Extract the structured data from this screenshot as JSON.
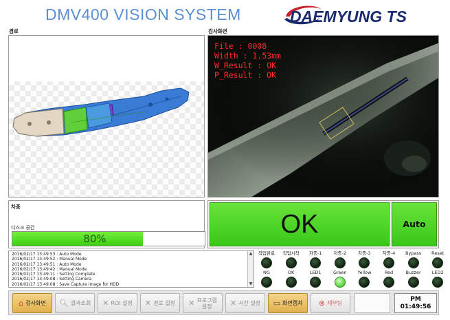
{
  "header": {
    "title": "DMV400 VISION SYSTEM",
    "logo_text": "DAEMYUNG TS"
  },
  "sections": {
    "route_label": "경로",
    "inspection_label": "검사화면",
    "car_label": "차종",
    "disk_label": "디스크 공간"
  },
  "camera_overlay": [
    "File : 0008",
    "Width : 1.53mm",
    "W_Result : OK",
    "P_Result : OK"
  ],
  "disk": {
    "percent_text": "80%",
    "fraction": 0.8
  },
  "result": {
    "main": "OK",
    "mode": "Auto"
  },
  "log": [
    "2016/02/17 13:49:53 : Auto Mode",
    "2016/02/17 13:49:52 : Manual Mode",
    "2016/02/17 13:49:51 : Auto Mode",
    "2016/02/17 13:49:42 : Manual Mode",
    "2016/02/17 13:49:11 : Setting Complete",
    "2016/02/17 13:49:08 : Setting Camera",
    "2016/02/17 13:49:08 : Save Capture Image for HDD"
  ],
  "indicators_row1": [
    {
      "label": "작업완료",
      "on": false
    },
    {
      "label": "작업시작",
      "on": false
    },
    {
      "label": "차종-1",
      "on": false
    },
    {
      "label": "차종-2",
      "on": false
    },
    {
      "label": "차종-3",
      "on": false
    },
    {
      "label": "차종-4",
      "on": false
    },
    {
      "label": "Bypass",
      "on": false
    },
    {
      "label": "Reset",
      "on": false
    }
  ],
  "indicators_row2": [
    {
      "label": "NG",
      "on": false
    },
    {
      "label": "OK",
      "on": false
    },
    {
      "label": "LED1",
      "on": false
    },
    {
      "label": "Green",
      "on": true
    },
    {
      "label": "Yellow",
      "on": false
    },
    {
      "label": "Red",
      "on": false
    },
    {
      "label": "Buzzer",
      "on": false
    },
    {
      "label": "LED2",
      "on": false
    }
  ],
  "toolbar": {
    "inspect": "검사화면",
    "results": "결과조회",
    "roi": "ROI 설정",
    "route": "경로 설정",
    "program_line1": "프로그램",
    "program_line2": "설정",
    "time": "시간 설정",
    "capture": "화면캡쳐",
    "reboot": "재부팅"
  },
  "clock": {
    "ampm": "PM",
    "time": "01:49:56"
  },
  "colors": {
    "title": "#5b8fd2",
    "ok_green": "#4cd42a",
    "overlay_red": "#ff2a2a"
  }
}
